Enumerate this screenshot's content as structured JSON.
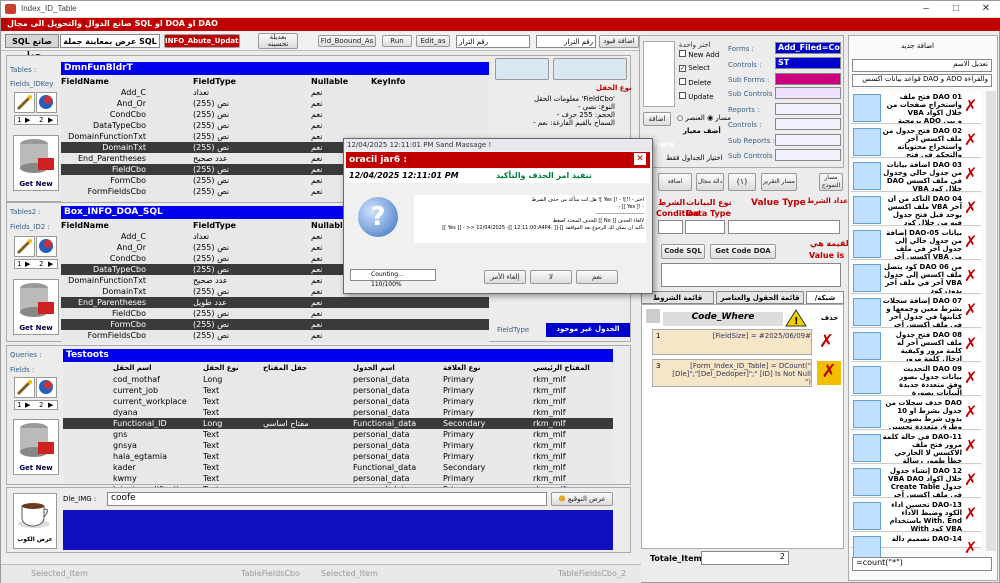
{
  "window": {
    "title": "Index_ID_Table",
    "banner": "صانع الدوال والتحويل الى مجال SQL او DOA او DAO"
  },
  "toolbar": {
    "tab_sql": "SQL صانع جمل",
    "tab_show": "عرض بمعاينة جملة SQL",
    "info_btn": "INFO_Abute_Update",
    "add_btn": "بعديلة تحسينه",
    "field_btn": "Fld_Boound_As",
    "run_btn": "Run",
    "edit_btn": "Edit_as",
    "field_no": "رقم الترار",
    "sql_no": "رقم الترار",
    "add_label": "اضافة قيود"
  },
  "tables": {
    "label": "Tables :",
    "fields_label": "Fields_IDKey",
    "header": "DmnFunBldrT",
    "cols": [
      "FieldName",
      "FieldType",
      "Nullable",
      "KeyInfo"
    ],
    "rows": [
      [
        "Add_C",
        "تعداد",
        "نعم",
        ""
      ],
      [
        "And_Or",
        "نص (255)",
        "نعم",
        ""
      ],
      [
        "CondCbo",
        "نص (255)",
        "نعم",
        ""
      ],
      [
        "DataTypeCbo",
        "نص (255)",
        "نعم",
        ""
      ],
      [
        "DomainFunctionTxt",
        "نص (255)",
        "نعم",
        ""
      ],
      [
        "DomainTxt",
        "نص (255)",
        "نعم",
        ""
      ],
      [
        "End_Parentheses",
        "عدد صحيح",
        "نعم",
        ""
      ],
      [
        "FieldCbo",
        "نص (255)",
        "نعم",
        ""
      ],
      [
        "FormCbo",
        "نص (255)",
        "نعم",
        ""
      ],
      [
        "FormFieldsCbo",
        "نص (255)",
        "نعم",
        ""
      ]
    ]
  },
  "tables2": {
    "label": "Tables2 :",
    "fields_label": "Fields_ID2 :",
    "header": "Box_INFO_DOA_SQL",
    "cols": [
      "FieldName",
      "FieldType",
      "Nullable",
      "KeyInfo"
    ],
    "rows": [
      [
        "Add_C",
        "تعداد",
        "نعم",
        ""
      ],
      [
        "And_Or",
        "نص (255)",
        "نعم",
        ""
      ],
      [
        "CondCbo",
        "نص (255)",
        "نعم",
        ""
      ],
      [
        "DataTypeCbo",
        "نص (255)",
        "نعم",
        ""
      ],
      [
        "DomainFunctionTxt",
        "عدد صحيح",
        "نعم",
        ""
      ],
      [
        "DomainTxt",
        "نص (255)",
        "نعم",
        ""
      ],
      [
        "End_Parentheses",
        "عدد طويل",
        "نعم",
        ""
      ],
      [
        "FieldCbo",
        "نص (255)",
        "نعم",
        ""
      ],
      [
        "FormCbo",
        "نص (255)",
        "نعم",
        ""
      ],
      [
        "FormFieldsCbo",
        "نص (255)",
        "نعم",
        ""
      ]
    ]
  },
  "queries": {
    "label": "Queries :",
    "fields_label": "Fields :",
    "header": "Testoots",
    "cols": [
      "اسم الحقل",
      "نوع الحقل",
      "حقل المفتاح",
      "اسم الجدول",
      "نوع العلاقة",
      "المفتاح الرئيسي"
    ],
    "rows": [
      [
        "cod_mothaf",
        "Long",
        "",
        "personal_data",
        "Primary",
        "rkm_mlf"
      ],
      [
        "current_job",
        "Text",
        "",
        "personal_data",
        "Primary",
        "rkm_mlf"
      ],
      [
        "current_workplace",
        "Text",
        "",
        "personal_data",
        "Primary",
        "rkm_mlf"
      ],
      [
        "dyana",
        "Text",
        "",
        "personal_data",
        "Primary",
        "rkm_mlf"
      ],
      [
        "Functional_ID",
        "Long",
        "مفتاح اساسي",
        "Functional_data",
        "Secondary",
        "rkm_mlf"
      ],
      [
        "gns",
        "Text",
        "",
        "personal_data",
        "Primary",
        "rkm_mlf"
      ],
      [
        "gnsya",
        "Text",
        "",
        "personal_data",
        "Primary",
        "rkm_mlf"
      ],
      [
        "hala_egtamia",
        "Text",
        "",
        "personal_data",
        "Primary",
        "rkm_mlf"
      ],
      [
        "kader",
        "Text",
        "",
        "Functional_data",
        "Secondary",
        "rkm_mlf"
      ],
      [
        "kwmy",
        "Text",
        "",
        "personal_data",
        "Primary",
        "rkm_mlf"
      ],
      [
        "latest_qualification",
        "Text",
        "",
        "personal_data",
        "Primary",
        "rkm_mlf"
      ]
    ]
  },
  "get_new": "Get New",
  "cup": {
    "label": "عرض الكوب",
    "dle_img": "Dle_IMG :",
    "value": "coofe",
    "show_btn": "عرض التوقيع"
  },
  "right_mid": {
    "new_add": "New Add",
    "select": "Select",
    "delete": "Delete",
    "update": "Update",
    "add_label": "اختر واحدة",
    "add_field": "اضافة",
    "hdr": "الجداول",
    "forms": "Forms :",
    "controls": "Controls :",
    "sub_forms": "Sub Forms :",
    "sub_controls": "Sub Controls :",
    "reports": "Reports :",
    "rcontrols": "Controls :",
    "sub_reports": "Sub Reports :",
    "rsub_controls": "Sub Controls :",
    "form_val": "Add_Filed=Co",
    "ctl_val": "ST",
    "type_label": "نوع الحقل",
    "info_lines": [
      "معلومات الحقل 'FieldCbo'",
      "- النوع: نصي",
      "- الحجم: 255 حرف",
      "- السماح بالقيم الفارغة: نعم"
    ],
    "fieldtype": "FieldType",
    "no_table": "الجدول غير موجود",
    "where": "here",
    "radio_a": "العنصر",
    "radio_b": "مسار",
    "btn_set": "اضافة",
    "sort": "أضف معيار",
    "filter": "اختيار الجداول فقط",
    "mode_btns": [
      "مسار النموذج",
      "مسار التقرير",
      "(١)",
      "دالة مجال",
      "اضافة"
    ],
    "cond_label": "Condition",
    "dtype_label": "Data Type",
    "dtype_ar": "نوع البيانات",
    "value_label": "Value Type",
    "cond_ar": "الشرط",
    "cond2": "اعداد الشرط",
    "val_ar": "القيمة هي",
    "val_is": "Value is",
    "btn_code_sql": "Code SQL",
    "btn_code_doa": "Get Code DOA",
    "tabs": [
      "شبكة/محلية",
      "قائمة الحقول والعناصر",
      "قائمة الشروط المنتجة"
    ],
    "code_where": "Code_Where",
    "del_label": "حذف",
    "where_rows": [
      {
        "n": "1",
        "t": "[FieldSize] = #2025/06/09#"
      },
      {
        "n": "3",
        "t": "[Form_Index_ID_Table] = DCount(\"[Dle]\";\"[Del_Dedoper]\";\" [ID] Is Not Null \")"
      }
    ],
    "totale": "Totale_Item",
    "totale_val": "2"
  },
  "dialog": {
    "title": "12/04/2025  12:11:01 PM  Sand Massage !",
    "name": "oracil jar6 :",
    "time": "12/04/2025 12:11:01 PM",
    "subtitle": "تنفيذ امر الحذف والتأكيد",
    "lines": [
      "هل انت متأكد من حذف الشرط ![ Yes ]! - ![!! - اختر",
      "- [[ Yes ]! -",
      "---------------------------",
      "للحذف المحدد اضغط [[ No ]] لالغاء الحذف",
      "[[ Yes ]] - >> 12/04/2025 -[[ 12:11:00:A4P4. ]]-[[ تأكيد ان يمكن لك الرجوع بعد الموافقة"
    ],
    "progress": "Counting... 110/100%",
    "btn_yes": "نعم",
    "btn_no": "لا",
    "btn_cancel": "إلغاء الأمر"
  },
  "right_panel": {
    "top_label": "اضافة جديد",
    "rename": "تعديل الاسم",
    "rule": "قواعد بيانات اكسس DAO و ADO والقراءة",
    "items": [
      "فتح ملف DAO 01 واستخراج صفحات من VBA خلال اكواد برمجية ADO و بين DAO",
      "فتح جدول من DAO 02 ملف اكسس آخر واستخراج محتوياته والتحكم في فتح الجداول",
      "اضافة بيانات DAO 03 من جدول حالي وجدول DAO في ملف اكسس VBA خلال كود",
      "التأكد من أن DAO 04 ملف اكسس VBA آخر يوجد قبل فتح جدول فيه من خلال كود",
      "إضافة DAO-05 بيانات من جدول حالي إلى جدول آخر في ملف اكسس آخر VBA من خلال كود",
      "كود يتصل DAO 06 من ملف اكسس إلى جدول آخر في ملف آخر VBA بدون كود",
      "إضافة سجلات DAO 07 بشرط معين وجمعها و كتابتها في جدول آخر في ملف اكسس آخر كود",
      "فتح جدول DAO 08 ملف اكسس آخر له كلمة مرور وكيفية ادخال كلمة مرور الملف من البرنامج",
      "التحديث DAO 09 بيانات جدول بصور وفق متعددة جديدة البيانات بصورة",
      "حذف سجلات من DAO 10 جدول بشرط او بدون شرط بصورة وطرق متعددة تحسين حذف سجلات",
      "في حالة كلمة DAO-11 مرور فتح ملف الاكسس لا الخارجي خطأ ظهور رسالة تطلب كلمة المرور",
      "إنشاء جدول DAO 12 VBA DAO خلال اكواد Create Table جدول في ملف اكسس آخر",
      "تحسين اداء DAO-13 الكود وضبط الأداء باستخدام With. End With كود VBA",
      "تصميم دالة DAO-14"
    ],
    "search_val": "=count(\"*\")"
  },
  "status": {
    "s1": "Selected_Item",
    "s2": "TableFieldsCbo",
    "s3": "Selected_Item",
    "s4": "TableFieldsCbo_2"
  }
}
